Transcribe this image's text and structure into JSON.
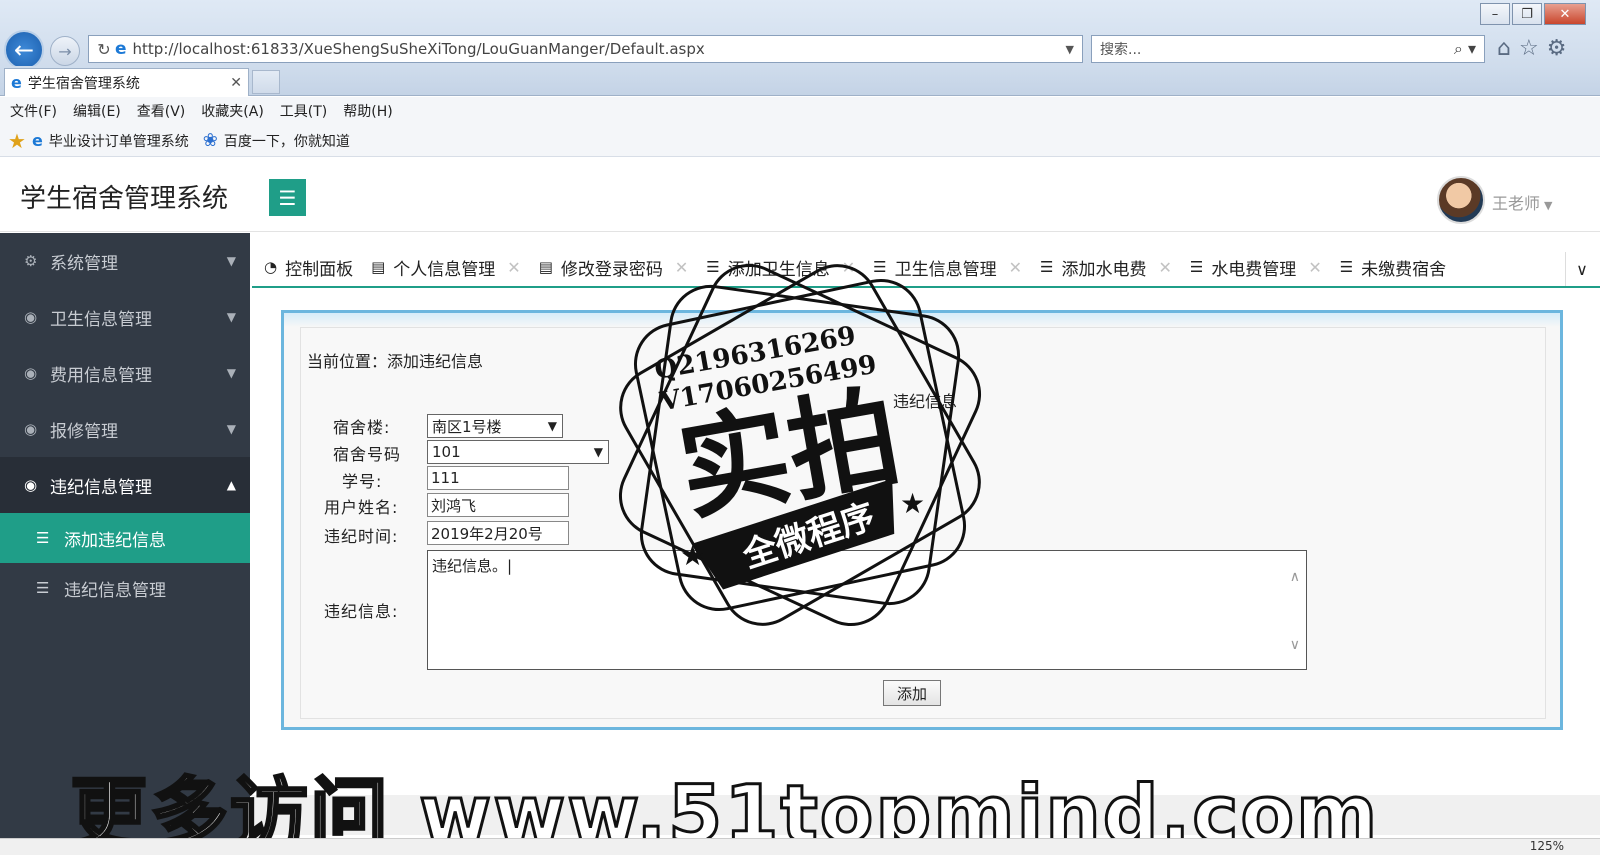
{
  "browser": {
    "url": "http://localhost:61833/XueShengSuSheXiTong/LouGuanManger/Default.aspx",
    "search_placeholder": "搜索...",
    "tab_title": "学生宿舍管理系统",
    "menu": [
      "文件(F)",
      "编辑(E)",
      "查看(V)",
      "收藏夹(A)",
      "工具(T)",
      "帮助(H)"
    ],
    "favorites": [
      "毕业设计订单管理系统",
      "百度一下，你就知道"
    ],
    "zoom": "125%"
  },
  "header": {
    "title": "学生宿舍管理系统",
    "user": "王老师"
  },
  "sidebar": {
    "items": [
      {
        "label": "系统管理"
      },
      {
        "label": "卫生信息管理"
      },
      {
        "label": "费用信息管理"
      },
      {
        "label": "报修管理"
      },
      {
        "label": "违纪信息管理"
      }
    ],
    "sub": [
      "添加违纪信息",
      "违纪信息管理"
    ]
  },
  "tabs": [
    "控制面板",
    "个人信息管理",
    "修改登录密码",
    "添加卫生信息",
    "卫生信息管理",
    "添加水电费",
    "水电费管理",
    "未缴费宿舍"
  ],
  "form": {
    "breadcrumb": "当前位置：添加违纪信息",
    "heading": "违纪信息",
    "building_label": "宿舍楼:",
    "building_value": "南区1号楼",
    "room_label": "宿舍号码",
    "room_value": "101",
    "student_label": "学号:",
    "student_value": "111",
    "name_label": "用户姓名:",
    "name_value": "刘鸿飞",
    "time_label": "违纪时间:",
    "time_value": "2019年2月20号",
    "info_label": "违纪信息:",
    "info_value": "违纪信息。|",
    "submit": "添加"
  },
  "watermark": {
    "line1": "Q2196316269",
    "line2": "V17060256499",
    "main": "实拍",
    "banner": "全微程序",
    "bottom": "更多访问 www.51topmind.com"
  }
}
